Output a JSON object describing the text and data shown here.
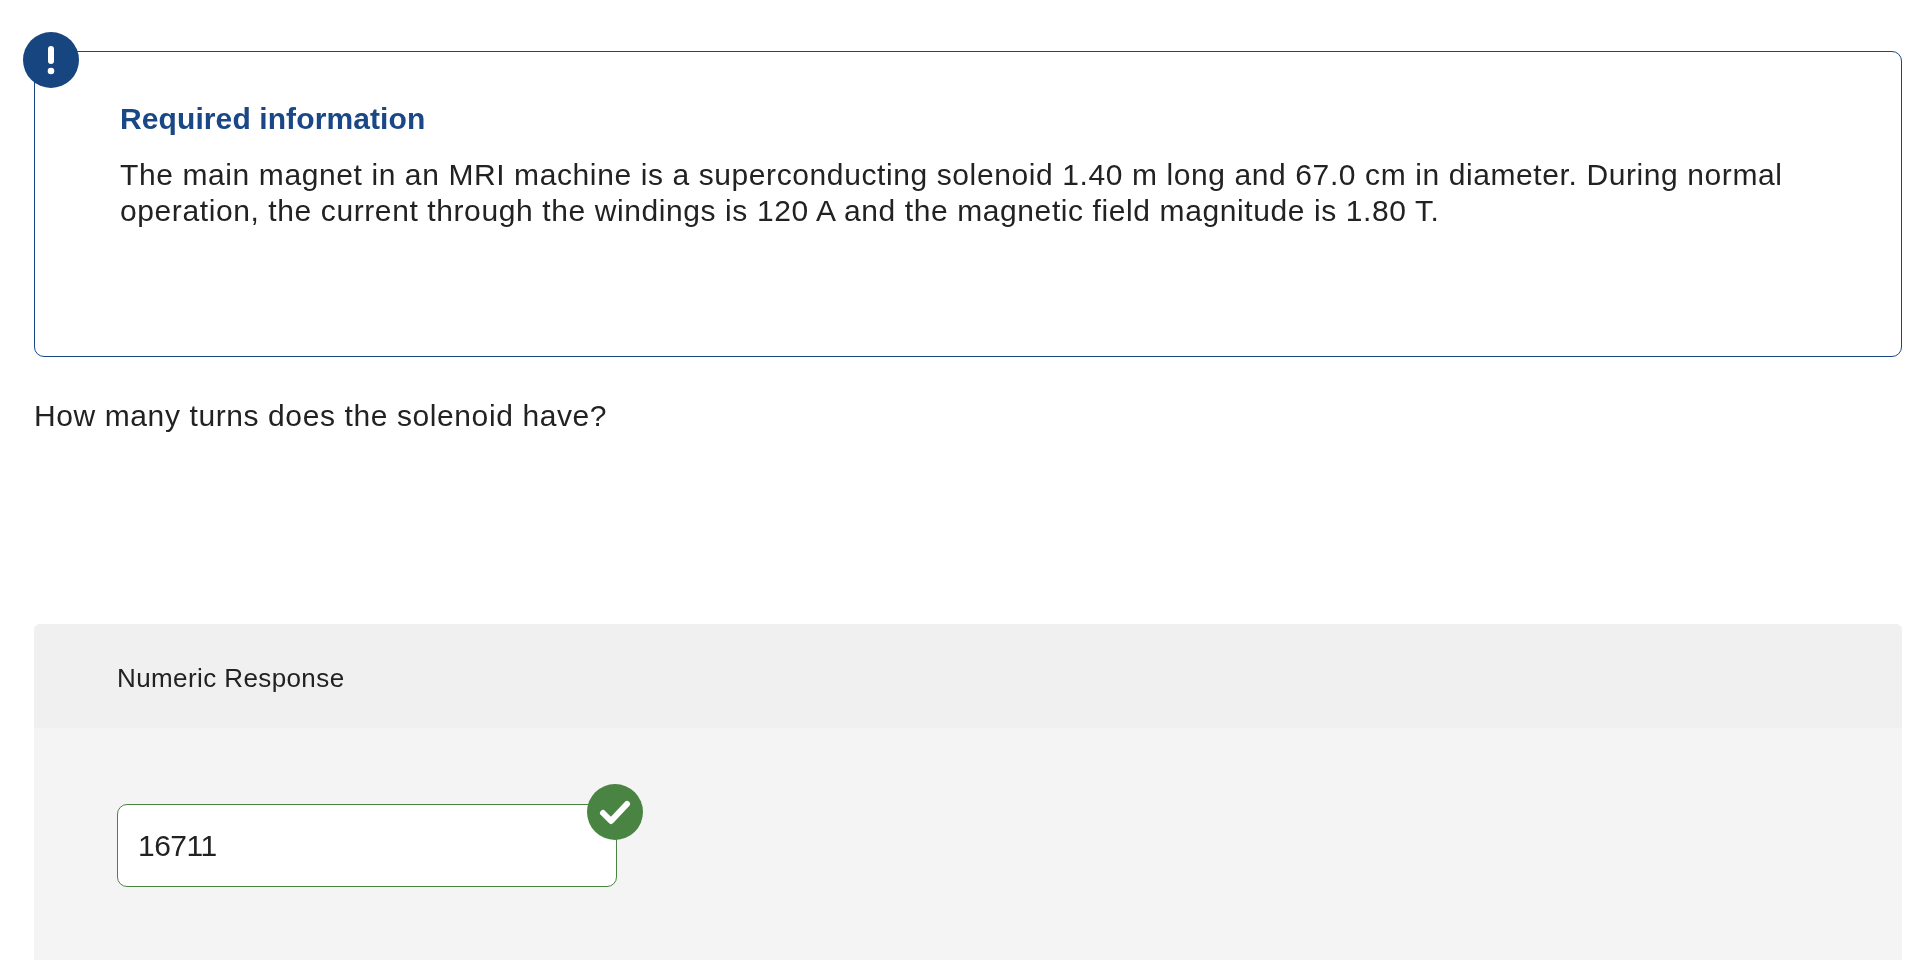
{
  "notice": {
    "title": "Required information",
    "text": "The main magnet in an MRI machine is a superconducting solenoid 1.40 m long and 67.0 cm in diameter. During normal operation, the current through the windings is 120 A and the magnetic field magnitude is 1.80 T."
  },
  "question": "How many turns does the solenoid have?",
  "response": {
    "label": "Numeric Response",
    "value": "16711",
    "correct": true
  }
}
